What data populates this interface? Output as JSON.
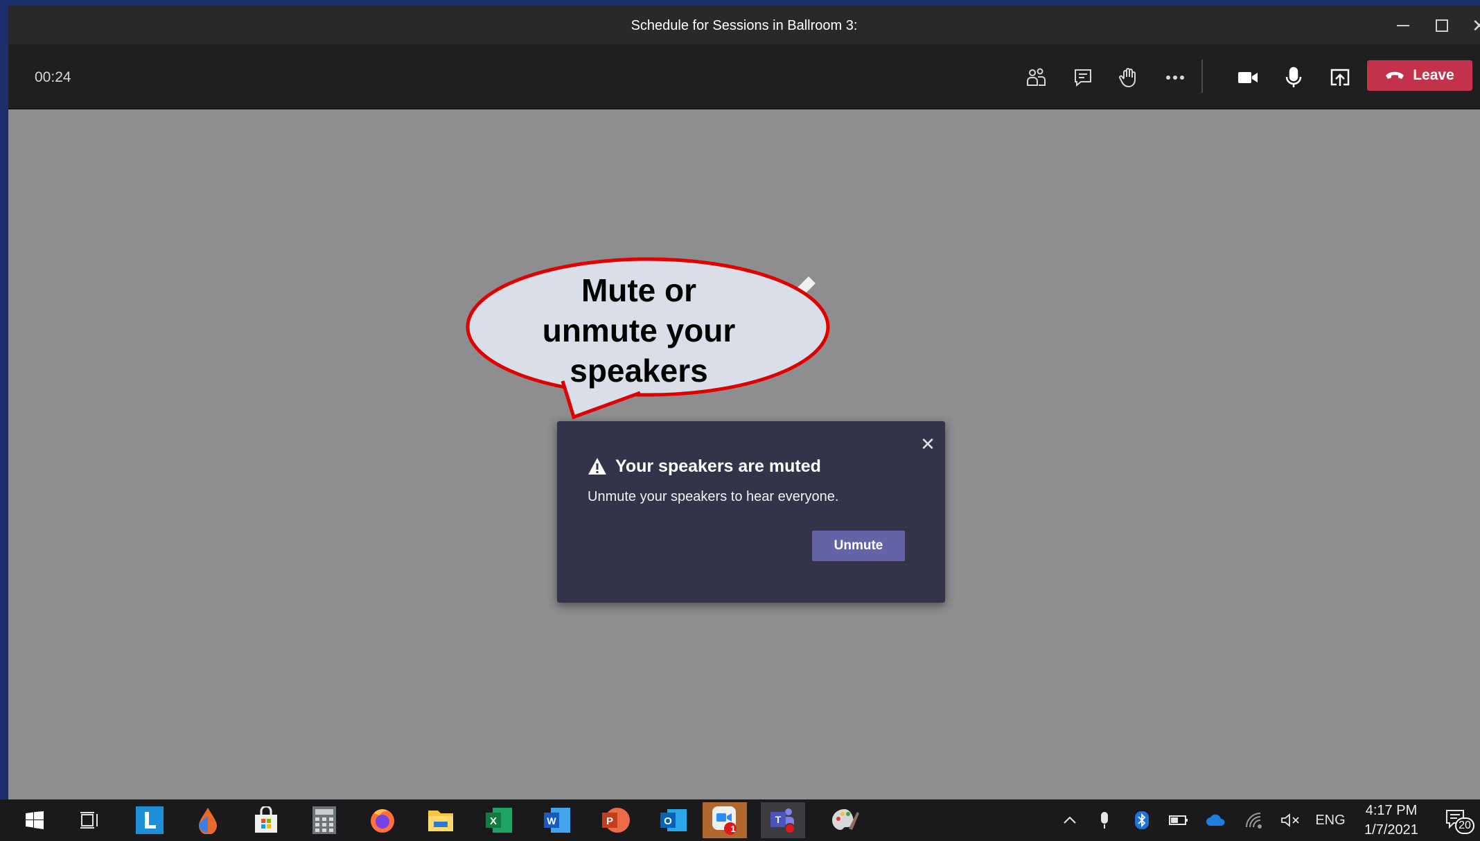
{
  "window": {
    "title": "Schedule for Sessions in Ballroom 3:",
    "controls": {
      "minimize_icon": "minimize-icon",
      "maximize_icon": "maximize-icon",
      "close_symbol": "✕"
    }
  },
  "callbar": {
    "timer": "00:24",
    "buttons": [
      "participants-icon",
      "chat-icon",
      "raise-hand-icon",
      "more-options-icon",
      "camera-icon",
      "microphone-icon",
      "share-screen-icon"
    ],
    "leave_label": "Leave",
    "leave_color": "#c4314b"
  },
  "callout": {
    "lines": [
      "Mute or",
      "unmute your",
      "speakers"
    ],
    "fill": "#d9dee8",
    "border": "#e00000"
  },
  "dialog": {
    "title": "Your speakers are muted",
    "body": "Unmute your speakers to hear everyone.",
    "button_label": "Unmute",
    "close_symbol": "✕",
    "accent": "#6264a7"
  },
  "taskbar": {
    "apps": [
      "start-icon",
      "task-view-icon",
      "l-app-icon",
      "color-drop-icon",
      "store-icon",
      "calculator-icon",
      "firefox-icon",
      "file-explorer-icon",
      "excel-icon",
      "word-icon",
      "powerpoint-icon",
      "outlook-icon",
      "zoom-icon",
      "teams-icon",
      "paint-icon"
    ],
    "zoom_badge": "1",
    "tray": {
      "language": "ENG",
      "time": "4:17 PM",
      "date": "1/7/2021",
      "notifications": "20"
    }
  }
}
